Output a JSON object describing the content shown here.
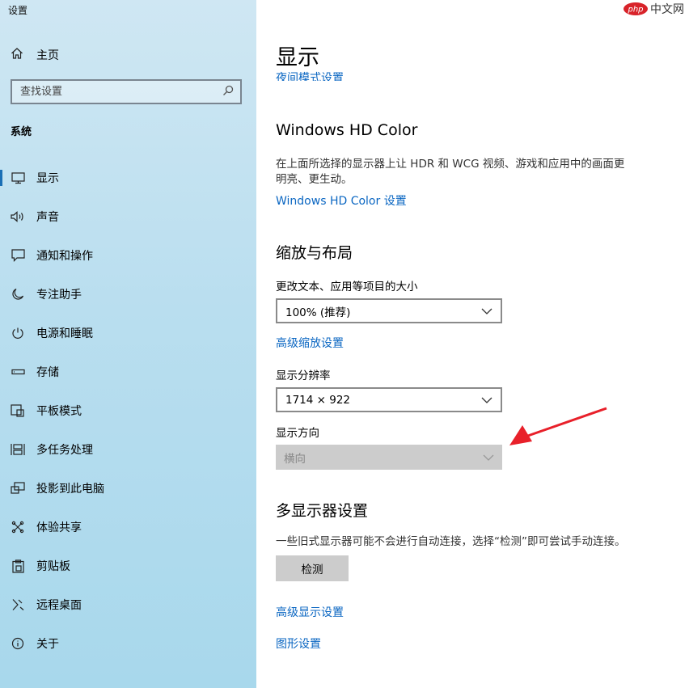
{
  "window": {
    "title": "设置"
  },
  "sidebar": {
    "home_label": "主页",
    "search_placeholder": "查找设置",
    "section_title": "系统",
    "items": [
      {
        "label": "显示",
        "icon": "monitor-icon",
        "active": true
      },
      {
        "label": "声音",
        "icon": "speaker-icon"
      },
      {
        "label": "通知和操作",
        "icon": "notification-icon"
      },
      {
        "label": "专注助手",
        "icon": "moon-icon"
      },
      {
        "label": "电源和睡眠",
        "icon": "power-icon"
      },
      {
        "label": "存储",
        "icon": "storage-icon"
      },
      {
        "label": "平板模式",
        "icon": "tablet-icon"
      },
      {
        "label": "多任务处理",
        "icon": "multitask-icon"
      },
      {
        "label": "投影到此电脑",
        "icon": "project-icon"
      },
      {
        "label": "体验共享",
        "icon": "share-icon"
      },
      {
        "label": "剪贴板",
        "icon": "clipboard-icon"
      },
      {
        "label": "远程桌面",
        "icon": "remote-icon"
      },
      {
        "label": "关于",
        "icon": "info-icon"
      }
    ]
  },
  "main": {
    "page_title": "显示",
    "night_mode_link": "夜间模式设置",
    "hdr": {
      "title": "Windows HD Color",
      "desc_line1": "在上面所选择的显示器上让 HDR 和 WCG 视频、游戏和应用中的画面更",
      "desc_line2": "明亮、更生动。",
      "link": "Windows HD Color 设置"
    },
    "scale": {
      "title": "缩放与布局",
      "size_label": "更改文本、应用等项目的大小",
      "size_value": "100% (推荐)",
      "advanced_link": "高级缩放设置",
      "resolution_label": "显示分辨率",
      "resolution_value": "1714 × 922",
      "orientation_label": "显示方向",
      "orientation_value": "横向"
    },
    "multi": {
      "title": "多显示器设置",
      "desc": "一些旧式显示器可能不会进行自动连接，选择“检测”即可尝试手动连接。",
      "detect_button": "检测",
      "advanced_display_link": "高级显示设置",
      "graphics_link": "图形设置"
    }
  },
  "watermark": {
    "text": "php中文网"
  },
  "colors": {
    "link": "#0a66c2",
    "annotation_arrow": "#e8202a",
    "watermark_red": "#d8232a"
  }
}
